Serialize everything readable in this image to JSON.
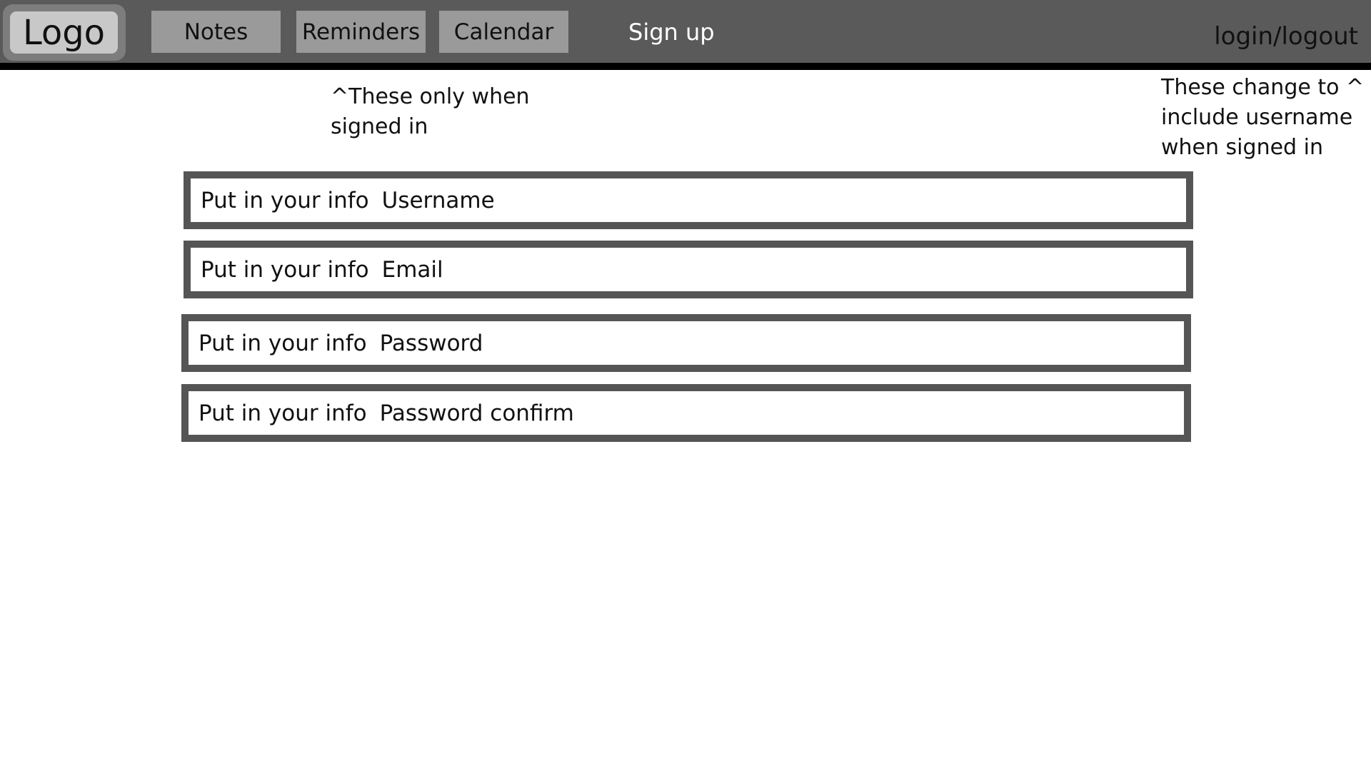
{
  "header": {
    "logo": "Logo",
    "nav": [
      {
        "label": "Notes"
      },
      {
        "label": "Reminders"
      },
      {
        "label": "Calendar"
      }
    ],
    "signup_label": "Sign up",
    "login_label": "login/logout"
  },
  "notes": {
    "signed_in_only": [
      "^These only when",
      "signed in"
    ],
    "username_change": [
      "These change to ^",
      "include username",
      "when signed in"
    ]
  },
  "form": {
    "fields": [
      {
        "label": "Put in your info",
        "placeholder": "Username"
      },
      {
        "label": "Put in your info",
        "placeholder": "Email"
      },
      {
        "label": "Put in your info",
        "placeholder": "Password"
      },
      {
        "label": "Put in your info",
        "placeholder": "Password confirm"
      }
    ]
  },
  "colors": {
    "header_bg": "#5a5a5a",
    "nav_button_bg": "#9a9a9a",
    "logo_bg": "#c8c8c8",
    "field_border": "#555555"
  }
}
